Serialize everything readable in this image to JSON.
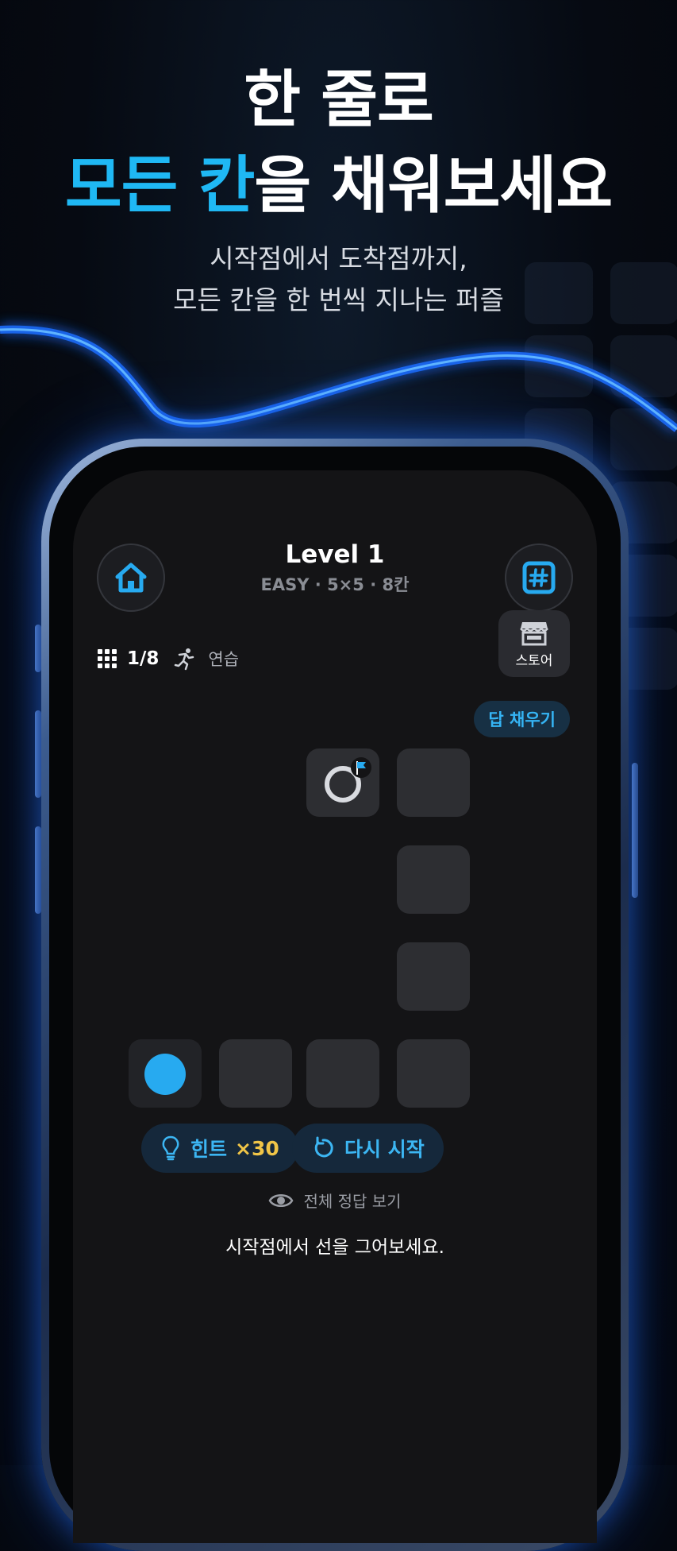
{
  "hero": {
    "line1": "한 줄로",
    "line2_accent": "모든 칸",
    "line2_rest": "을 채워보세요",
    "sub1": "시작점에서 도착점까지,",
    "sub2": "모든 칸을 한 번씩 지나는 퍼즐"
  },
  "header": {
    "home_icon": "home-icon",
    "title": "Level 1",
    "subtitle": "EASY · 5×5 · 8칸",
    "grid_icon": "hashtag-icon"
  },
  "stats": {
    "grid_icon": "grid-dots-icon",
    "progress": "1/8",
    "mode_icon": "running-person-icon",
    "mode": "연습"
  },
  "store": {
    "icon": "storefront-icon",
    "label": "스토어"
  },
  "fill_answer": {
    "label": "답 채우기"
  },
  "board": {
    "rows": 5,
    "cols": 5,
    "start": "dot",
    "end": "flag"
  },
  "controls": {
    "hint_icon": "lightbulb-icon",
    "hint_label": "힌트",
    "hint_count": "×30",
    "restart_icon": "restart-icon",
    "restart_label": "다시 시작"
  },
  "answer_link": {
    "icon": "eye-icon",
    "label": "전체 정답 보기"
  },
  "message": "시작점에서 선을 그어보세요.",
  "colors": {
    "accent": "#1fb8f4",
    "gold": "#f0c547",
    "background": "#060a12",
    "cell": "#2d2e32"
  }
}
